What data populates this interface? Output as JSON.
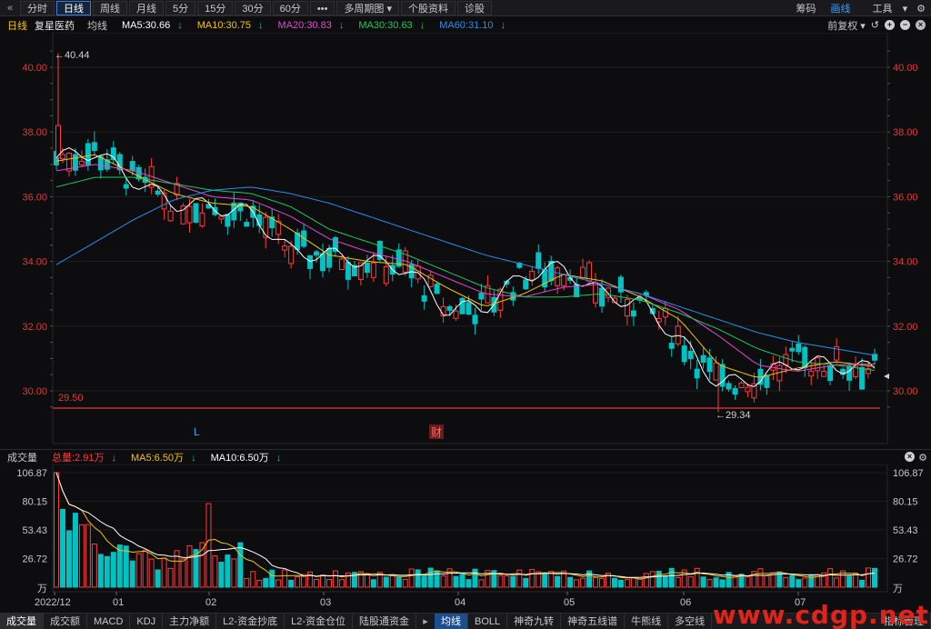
{
  "toolbar": {
    "periods": [
      "分时",
      "日线",
      "周线",
      "月线",
      "5分",
      "15分",
      "30分",
      "60分",
      "•••",
      "多周期图",
      "个股资料",
      "诊股"
    ],
    "active_period": "日线",
    "right": [
      "筹码",
      "画线",
      "工具"
    ]
  },
  "legend": {
    "period": "日线",
    "name": "复星医药",
    "type": "均线",
    "ma5": "MA5:30.66",
    "ma10": "MA10:30.75",
    "ma20": "MA20:30.83",
    "ma30": "MA30:30.63",
    "ma60": "MA60:31.10",
    "adjust": "前复权"
  },
  "price_axis": [
    "40.00",
    "38.00",
    "36.00",
    "34.00",
    "32.00",
    "30.00"
  ],
  "annotations": {
    "high": "←40.44",
    "low": "←29.34",
    "line_level": "29.50",
    "marker_l": "L",
    "marker_cai": "财"
  },
  "volume_head": {
    "title": "成交量",
    "total": "总量:2.91万",
    "ma5": "MA5:6.50万",
    "ma10": "MA10:6.50万"
  },
  "volume_axis": [
    "106.87",
    "80.15",
    "53.43",
    "26.72",
    "万"
  ],
  "date_axis": [
    "2022/12",
    "01",
    "02",
    "03",
    "04",
    "05",
    "06",
    "07"
  ],
  "tabs": [
    "成交量",
    "成交额",
    "MACD",
    "KDJ",
    "主力净额",
    "L2-资金抄底",
    "L2-资金仓位",
    "陆股通资金",
    "均线",
    "BOLL",
    "神奇九转",
    "神奇五线谱",
    "牛熊线",
    "多空线",
    "指标管理"
  ],
  "watermark": "www.cdgp.net",
  "colors": {
    "up": "#ff3b3b",
    "down": "#00c2c2",
    "ma5": "#ffffff",
    "ma10": "#f5c400",
    "ma20": "#e24bd2",
    "ma30": "#20c760",
    "ma60": "#2d8cf0"
  },
  "chart_data": {
    "type": "candlestick",
    "ylim": [
      29.34,
      40.44
    ],
    "ma_series": [
      {
        "name": "MA5",
        "values": [
          37.2,
          37.4,
          36.5,
          35.8,
          35.7,
          35.5,
          34.3,
          34.2,
          34.0,
          33.8,
          32.5,
          32.6,
          33.6,
          33.8,
          33.0,
          32.7,
          31.6,
          30.2,
          30.4,
          30.9,
          30.8,
          30.66
        ]
      },
      {
        "name": "MA10",
        "values": [
          37.1,
          37.3,
          36.7,
          36.1,
          35.8,
          35.7,
          35.0,
          34.2,
          34.0,
          33.9,
          33.2,
          32.6,
          33.0,
          33.6,
          33.4,
          32.9,
          32.2,
          30.8,
          30.4,
          30.7,
          30.9,
          30.75
        ]
      },
      {
        "name": "MA20",
        "values": [
          36.8,
          37.0,
          36.8,
          36.4,
          36.0,
          35.9,
          35.4,
          34.7,
          34.3,
          34.0,
          33.5,
          33.0,
          32.9,
          33.2,
          33.3,
          33.0,
          32.5,
          31.7,
          30.8,
          30.6,
          30.8,
          30.83
        ]
      },
      {
        "name": "MA30",
        "values": [
          36.3,
          36.6,
          36.6,
          36.4,
          36.2,
          36.1,
          35.7,
          35.0,
          34.6,
          34.2,
          33.7,
          33.2,
          32.9,
          32.9,
          33.0,
          32.8,
          32.4,
          31.9,
          31.3,
          30.9,
          30.8,
          30.63
        ]
      },
      {
        "name": "MA60",
        "values": [
          33.9,
          34.6,
          35.3,
          35.9,
          36.2,
          36.3,
          36.1,
          35.8,
          35.4,
          35.0,
          34.6,
          34.2,
          33.9,
          33.6,
          33.3,
          33.0,
          32.6,
          32.2,
          31.8,
          31.5,
          31.3,
          31.1
        ]
      }
    ],
    "volume_ylim": [
      0,
      106.87
    ]
  }
}
